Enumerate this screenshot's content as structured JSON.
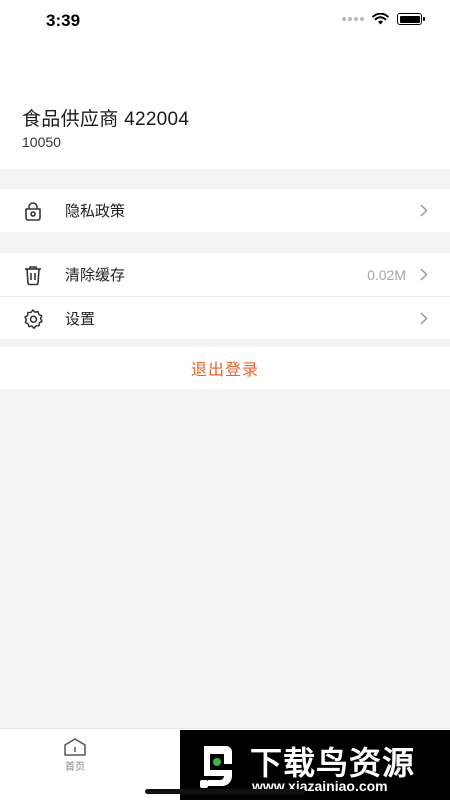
{
  "status_bar": {
    "time": "3:39"
  },
  "profile": {
    "name": "食品供应商 422004",
    "id": "10050"
  },
  "menu": {
    "privacy": {
      "label": "隐私政策"
    },
    "clear_cache": {
      "label": "清除缓存",
      "value": "0.02M"
    },
    "settings": {
      "label": "设置"
    }
  },
  "logout": {
    "label": "退出登录"
  },
  "tabbar": {
    "home_label": "首页"
  },
  "watermark": {
    "title": "下载鸟资源",
    "url": "www.xiazainiao.com"
  },
  "colors": {
    "accent": "#e8622a",
    "background": "#f4f4f4"
  }
}
